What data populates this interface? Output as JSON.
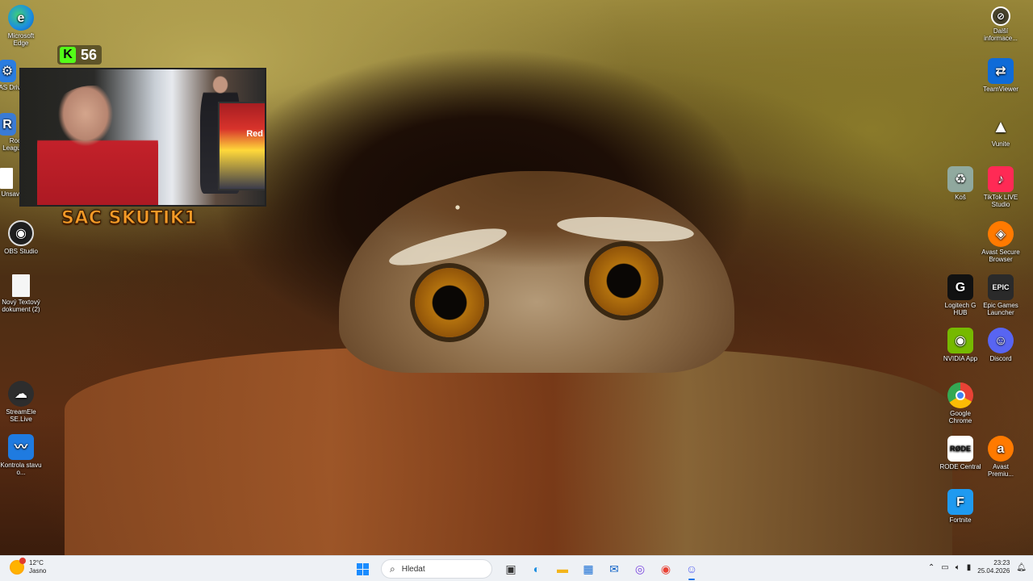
{
  "desktop": {
    "left_icons": [
      {
        "label": "Microsoft Edge",
        "icon": "edge-icon",
        "color": "#1b8de0"
      },
      {
        "label": "AS Drive",
        "icon": "as-drive-icon",
        "color": "#2a7de1"
      },
      {
        "label": "Rock League",
        "icon": "rocket-league-icon",
        "color": "#3a7bd5"
      },
      {
        "label": "Unsav",
        "icon": "file-icon",
        "color": "#ffffff"
      },
      {
        "label": "OBS Studio",
        "icon": "obs-icon",
        "color": "#222222"
      },
      {
        "label": "Nový Textový dokument (2)",
        "icon": "text-document-icon",
        "color": "#f2f2f2"
      },
      {
        "label": "StreamEle SE.Live",
        "icon": "streamelements-icon",
        "color": "#2d2d2d"
      },
      {
        "label": "Kontrola stavu o...",
        "icon": "pc-health-icon",
        "color": "#1f7be0"
      }
    ],
    "right_icons": [
      {
        "label": "Další informace...",
        "icon": "wallpaper-info-icon",
        "color": "#444444"
      },
      {
        "label": "TeamViewer",
        "icon": "teamviewer-icon",
        "color": "#0e6bd8"
      },
      {
        "label": "Vunite",
        "icon": "vunite-icon",
        "color": "#2b2b2b"
      },
      {
        "label": "Koš",
        "icon": "recycle-bin-icon",
        "color": "#9fd3f0"
      },
      {
        "label": "TikTok LIVE Studio",
        "icon": "tiktok-icon",
        "color": "#ff2a55"
      },
      {
        "label": "Avast Secure Browser",
        "icon": "avast-browser-icon",
        "color": "#ff7a00"
      },
      {
        "label": "Logitech G HUB",
        "icon": "logitech-icon",
        "color": "#111111"
      },
      {
        "label": "Epic Games Launcher",
        "icon": "epic-games-icon",
        "color": "#2a2a2a"
      },
      {
        "label": "NVIDIA App",
        "icon": "nvidia-icon",
        "color": "#76b900"
      },
      {
        "label": "Discord",
        "icon": "discord-icon",
        "color": "#5865f2"
      },
      {
        "label": "Google Chrome",
        "icon": "chrome-icon",
        "color": "#e94235"
      },
      {
        "label": "RODE Central",
        "icon": "rode-icon",
        "color": "#ffffff"
      },
      {
        "label": "Avast Premiu...",
        "icon": "avast-icon",
        "color": "#ff7a00"
      },
      {
        "label": "Fortnite",
        "icon": "fortnite-icon",
        "color": "#1f9af0"
      }
    ]
  },
  "overlay": {
    "kick_count": "56",
    "kick_letter": "K",
    "sac_text": "SAC SKUTIK1",
    "fridge_text": "Red"
  },
  "taskbar": {
    "weather_temp": "12°C",
    "weather_desc": "Jasno",
    "search_placeholder": "Hledat",
    "time": "23:23",
    "date": "25.04.2026"
  }
}
